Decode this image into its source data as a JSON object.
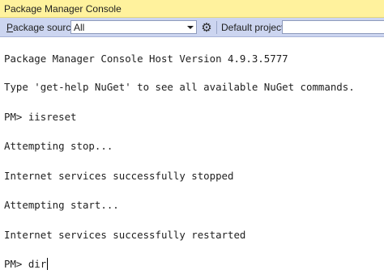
{
  "window": {
    "title": "Package Manager Console"
  },
  "toolbar": {
    "package_source_label_mnemonic": "P",
    "package_source_label_rest": "ackage source:",
    "package_source_value": "All",
    "settings_icon": "gear-icon",
    "default_project_label": "Default project:",
    "default_project_value": ""
  },
  "console": {
    "lines": [
      "Package Manager Console Host Version 4.9.3.5777",
      "Type 'get-help NuGet' to see all available NuGet commands.",
      "PM> iisreset",
      "Attempting stop...",
      "Internet services successfully stopped",
      "Attempting start...",
      "Internet services successfully restarted",
      "PM> dir"
    ]
  }
}
